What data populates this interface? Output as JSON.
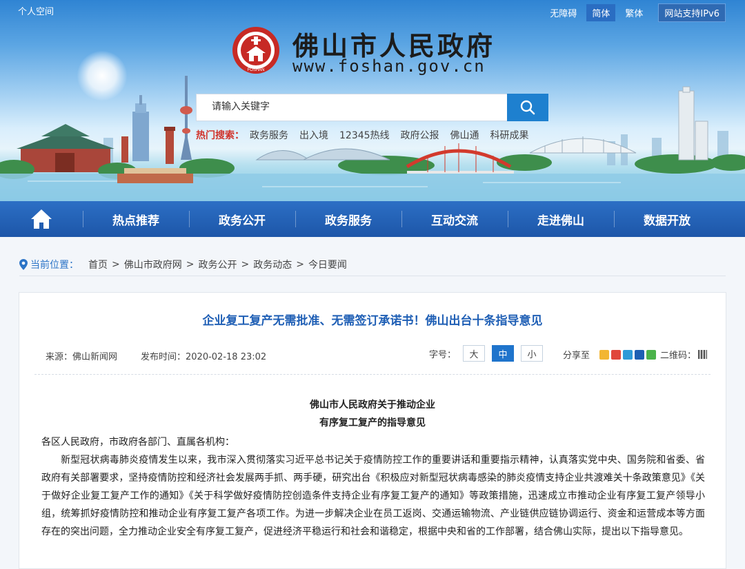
{
  "topbar": {
    "personal": "个人空间",
    "accessibility": "无障碍",
    "simplified": "简体",
    "traditional": "繁体",
    "ipv6": "网站支持IPv6"
  },
  "header": {
    "title": "佛山市人民政府",
    "url": "www.foshan.gov.cn",
    "emblem_text": "FOSHAN"
  },
  "search": {
    "placeholder": "请输入关键字",
    "hot_label": "热门搜索：",
    "hot_items": [
      "政务服务",
      "出入境",
      "12345热线",
      "政府公报",
      "佛山通",
      "科研成果"
    ]
  },
  "nav": {
    "items": [
      "热点推荐",
      "政务公开",
      "政务服务",
      "互动交流",
      "走进佛山",
      "数据开放"
    ]
  },
  "breadcrumb": {
    "label": "当前位置：",
    "items": [
      "首页",
      "佛山市政府网",
      "政务公开",
      "政务动态",
      "今日要闻"
    ]
  },
  "article": {
    "headline": "企业复工复产无需批准、无需签订承诺书！佛山出台十条指导意见",
    "source": "来源：佛山新闻网",
    "publish_time": "发布时间：2020-02-18 23:02",
    "font_label": "字号：",
    "font_large": "大",
    "font_medium": "中",
    "font_small": "小",
    "share_label": "分享至",
    "qr_label": "二维码：",
    "doc_title_1": "佛山市人民政府关于推动企业",
    "doc_title_2": "有序复工复产的指导意见",
    "salutation": "各区人民政府，市政府各部门、直属各机构：",
    "paragraph": "新型冠状病毒肺炎疫情发生以来，我市深入贯彻落实习近平总书记关于疫情防控工作的重要讲话和重要指示精神，认真落实党中央、国务院和省委、省政府有关部署要求，坚持疫情防控和经济社会发展两手抓、两手硬，研究出台《积极应对新型冠状病毒感染的肺炎疫情支持企业共渡难关十条政策意见》《关于做好企业复工复产工作的通知》《关于科学做好疫情防控创造条件支持企业有序复工复产的通知》等政策措施，迅速成立市推动企业有序复工复产领导小组，统筹抓好疫情防控和推动企业有序复工复产各项工作。为进一步解决企业在员工返岗、交通运输物流、产业链供应链协调运行、资金和运营成本等方面存在的突出问题，全力推动企业安全有序复工复产，促进经济平稳运行和社会和谐稳定，根据中央和省的工作部署，结合佛山实际，提出以下指导意见。"
  },
  "colors": {
    "nav_blue": "#2163b8",
    "headline_blue": "#1f5fb5",
    "hot_red": "#d0342c",
    "search_btn": "#1e80cf"
  }
}
